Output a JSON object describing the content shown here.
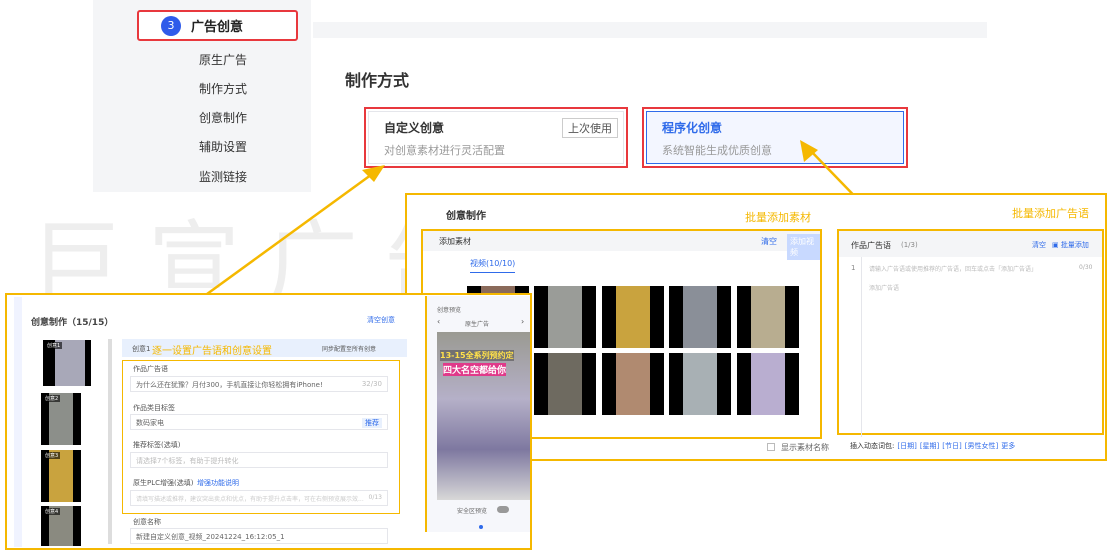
{
  "sidebar": {
    "step_number": "3",
    "step_label": "广告创意",
    "items": [
      "原生广告",
      "制作方式",
      "创意制作",
      "辅助设置",
      "监测链接"
    ]
  },
  "section": {
    "title": "制作方式",
    "cards": [
      {
        "title": "自定义创意",
        "subtitle": "对创意素材进行灵活配置",
        "badge": "上次使用"
      },
      {
        "title": "程序化创意",
        "subtitle": "系统智能生成优质创意"
      }
    ]
  },
  "watermark": "巨宣广告",
  "programmatic": {
    "title": "创意制作",
    "annotation_materials": "批量添加素材",
    "annotation_ads": "批量添加广告语",
    "materials": {
      "title": "添加素材",
      "clear": "清空",
      "add_video": "添加视频",
      "tab": "视频(10/10)",
      "show_names": "显示素材名称"
    },
    "ad_copy": {
      "title": "作品广告语",
      "count": "(1/3)",
      "clear": "清空",
      "batch_add": "批量添加",
      "line_no": "1",
      "placeholder": "请输入广告语或使用推荐的广告语，回车或点击「添加广告语」",
      "counter": "0/30",
      "add": "添加广告语",
      "insert_label": "插入动态词包:",
      "words": [
        "[日期]",
        "[星期]",
        "[节日]",
        "[男性女性]",
        "更多"
      ]
    }
  },
  "custom": {
    "title": "创意制作（15/15）",
    "clear": "清空创意",
    "creative_label": "创意1",
    "annotation": "逐一设置广告语和创意设置",
    "sync": "同步配置至所有创意",
    "thumb_labels": [
      "创意1",
      "创意2",
      "创意3",
      "创意4"
    ],
    "fields": {
      "ad_label": "作品广告语",
      "ad_value": "为什么还在犹豫？月付300，手机直接让你轻松拥有iPhone!",
      "ad_count": "32/30",
      "cat_label": "作品类目标签",
      "cat_value": "数码家电",
      "cat_tag": "推荐",
      "tags_label": "推荐标签(选填)",
      "tags_placeholder": "请选择7个标签，有助于提升转化",
      "plc_label": "原生PLC增强(选填)",
      "plc_link": "增强功能说明",
      "plc_placeholder": "请填写描述或推荐，建议突出卖点和优点，有助于提升点击率，可在右侧预览展示效...",
      "plc_count": "0/13",
      "name_label": "创意名称",
      "name_value": "新建自定义创意_视频_20241224_16:12:05_1"
    }
  },
  "preview": {
    "title": "创意预览",
    "mode": "原生广告",
    "headline1": "13-15全系列预约定",
    "headline2": "四大名空都给你",
    "safe_area": "安全区预览"
  }
}
